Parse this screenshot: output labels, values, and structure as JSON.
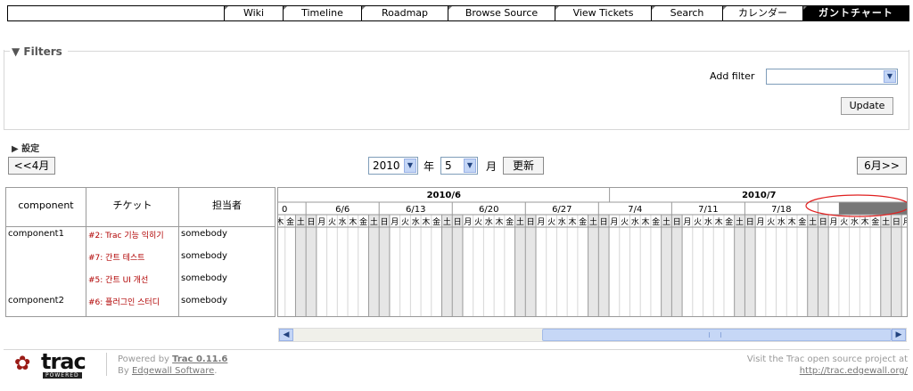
{
  "topnav": {
    "items": [
      {
        "label": "Wiki",
        "active": false
      },
      {
        "label": "Timeline",
        "active": false
      },
      {
        "label": "Roadmap",
        "active": false
      },
      {
        "label": "Browse Source",
        "active": false
      },
      {
        "label": "View Tickets",
        "active": false
      },
      {
        "label": "Search",
        "active": false
      },
      {
        "label": "カレンダー",
        "active": false
      },
      {
        "label": "ガントチャート",
        "active": true
      }
    ]
  },
  "filters": {
    "legend": "▼ Filters",
    "add_filter_label": "Add filter",
    "add_filter_value": "",
    "update_label": "Update"
  },
  "settings": {
    "label": "▶ 設定"
  },
  "navigation": {
    "prev_label": "<<4月",
    "next_label": "6月>>",
    "year_value": "2010",
    "year_unit": "年",
    "month_value": "5",
    "month_unit": "月",
    "refresh_label": "更新"
  },
  "gantt": {
    "headers": {
      "component": "component",
      "ticket": "チケット",
      "owner": "担当者"
    },
    "rows": [
      {
        "component": "component1",
        "ticket": "#2: Trac 기능 익히기",
        "owner": "somebody"
      },
      {
        "component": "",
        "ticket": "#7: 간트 테스트",
        "owner": "somebody"
      },
      {
        "component": "",
        "ticket": "#5: 간트 UI 개선",
        "owner": "somebody"
      },
      {
        "component": "component2",
        "ticket": "#6: 플러그인 스터디",
        "owner": "somebody"
      }
    ],
    "months": [
      "2010/6",
      "2010/7"
    ],
    "weeks": [
      "0",
      "6/6",
      "6/13",
      "6/20",
      "6/27",
      "7/4",
      "7/11",
      "7/18"
    ],
    "day_cycle": [
      "木",
      "金",
      "土",
      "日",
      "月",
      "火",
      "水"
    ],
    "colors": {
      "border": "#9a9a9a",
      "weekend": "#e6e6e6",
      "overflow_header": "#777777",
      "annotation_circle": "#e02020"
    }
  },
  "footer": {
    "logo_text": "trac",
    "logo_badge": "POWERED",
    "powered_by_prefix": "Powered by ",
    "powered_by_product": "Trac 0.11.6",
    "by_prefix": "By ",
    "by_company": "Edgewall Software",
    "by_suffix": ".",
    "visit_text": "Visit the Trac open source project at",
    "visit_url": "http://trac.edgewall.org/"
  }
}
